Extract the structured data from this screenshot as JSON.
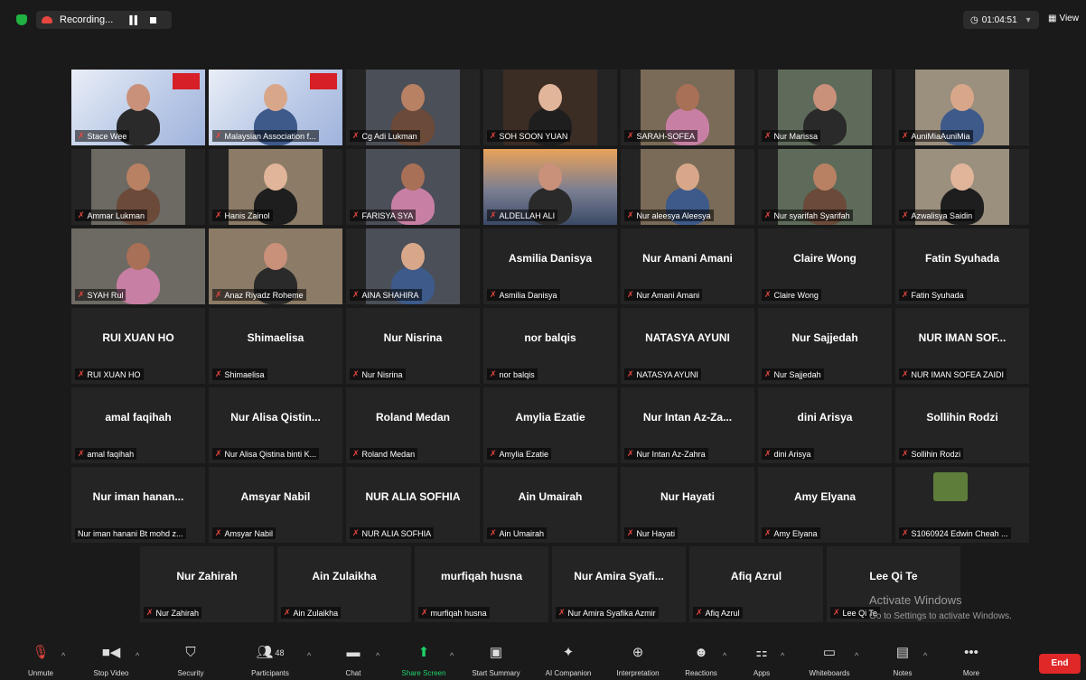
{
  "recording": {
    "label": "Recording...",
    "pause_icon": "pause-icon",
    "stop_icon": "stop-icon"
  },
  "timer": {
    "value": "01:04:51"
  },
  "view": {
    "label": "View"
  },
  "grid": [
    {
      "big": "",
      "name": "Stace Wee",
      "video": true
    },
    {
      "big": "",
      "name": "Malaysian Association f...",
      "video": true
    },
    {
      "big": "",
      "name": "Cg Adi Lukman",
      "video": true
    },
    {
      "big": "",
      "name": "SOH SOON YUAN",
      "video": true
    },
    {
      "big": "",
      "name": "SARAH-SOFEA",
      "video": true
    },
    {
      "big": "",
      "name": "Nur Marissa",
      "video": true
    },
    {
      "big": "",
      "name": "AuniMiaAuniMia",
      "video": true
    },
    {
      "big": "",
      "name": "Ammar Lukman",
      "video": true
    },
    {
      "big": "",
      "name": "Hanis Zainol",
      "video": true
    },
    {
      "big": "",
      "name": "FARISYA SYA",
      "video": true
    },
    {
      "big": "",
      "name": "ALDELLAH ALI",
      "video": true
    },
    {
      "big": "",
      "name": "Nur aleesya Aleesya",
      "video": true
    },
    {
      "big": "",
      "name": "Nur syarifah Syarifah",
      "video": true
    },
    {
      "big": "",
      "name": "Azwalisya Saidin",
      "video": true
    },
    {
      "big": "",
      "name": "SYAH Rul",
      "video": true
    },
    {
      "big": "",
      "name": "Anaz Riyadz Roheme",
      "video": true
    },
    {
      "big": "",
      "name": "AINA SHAHIRA",
      "video": true
    },
    {
      "big": "Asmilia Danisya",
      "name": "Asmilia Danisya"
    },
    {
      "big": "Nur Amani Amani",
      "name": "Nur Amani Amani"
    },
    {
      "big": "Claire Wong",
      "name": "Claire Wong"
    },
    {
      "big": "Fatin Syuhada",
      "name": "Fatin Syuhada"
    },
    {
      "big": "RUI XUAN HO",
      "name": "RUI XUAN HO"
    },
    {
      "big": "Shimaelisa",
      "name": "Shimaelisa"
    },
    {
      "big": "Nur Nisrina",
      "name": "Nur Nisrina"
    },
    {
      "big": "nor balqis",
      "name": "nor balqis"
    },
    {
      "big": "NATASYA AYUNI",
      "name": "NATASYA AYUNI"
    },
    {
      "big": "Nur Sajjedah",
      "name": "Nur Sajjedah"
    },
    {
      "big": "NUR IMAN SOF...",
      "name": "NUR IMAN SOFEA ZAIDI"
    },
    {
      "big": "amal faqihah",
      "name": "amal faqihah"
    },
    {
      "big": "Nur Alisa Qistin...",
      "name": "Nur Alisa Qistina binti K..."
    },
    {
      "big": "Roland Medan",
      "name": "Roland Medan"
    },
    {
      "big": "Amylia Ezatie",
      "name": "Amylia Ezatie"
    },
    {
      "big": "Nur Intan Az-Za...",
      "name": "Nur Intan Az-Zahra"
    },
    {
      "big": "dini Arisya",
      "name": "dini Arisya"
    },
    {
      "big": "Sollihin Rodzi",
      "name": "Sollihin Rodzi"
    },
    {
      "big": "Nur iman hanan...",
      "name": "Nur iman hanani Bt mohd z..."
    },
    {
      "big": "Amsyar Nabil",
      "name": "Amsyar Nabil"
    },
    {
      "big": "NUR ALIA SOFHIA",
      "name": "NUR ALIA SOFHIA"
    },
    {
      "big": "Ain Umairah",
      "name": "Ain Umairah"
    },
    {
      "big": "Nur Hayati",
      "name": "Nur Hayati"
    },
    {
      "big": "Amy Elyana",
      "name": "Amy Elyana"
    },
    {
      "big": "",
      "name": "S1060924 Edwin Cheah ...",
      "avatar": true
    }
  ],
  "last_row": [
    {
      "big": "Nur Zahirah",
      "name": "Nur Zahirah"
    },
    {
      "big": "Ain Zulaikha",
      "name": "Ain Zulaikha"
    },
    {
      "big": "murfiqah husna",
      "name": "murfiqah husna"
    },
    {
      "big": "Nur Amira Syafi...",
      "name": "Nur Amira Syafika Azmir"
    },
    {
      "big": "Afiq Azrul",
      "name": "Afiq Azrul"
    },
    {
      "big": "Lee Qi Te",
      "name": "Lee Qi Te"
    }
  ],
  "watermark": {
    "title": "Activate Windows",
    "subtitle": "Go to Settings to activate Windows."
  },
  "toolbar": {
    "unmute": "Unmute",
    "stop_video": "Stop Video",
    "security": "Security",
    "participants": "Participants",
    "participants_count": "48",
    "chat": "Chat",
    "share_screen": "Share Screen",
    "start_summary": "Start Summary",
    "ai_companion": "AI Companion",
    "interpretation": "Interpretation",
    "reactions": "Reactions",
    "apps": "Apps",
    "whiteboards": "Whiteboards",
    "notes": "Notes",
    "more": "More",
    "end": "End"
  },
  "colors": {
    "share_green": "#1fd16a",
    "end_red": "#e02828",
    "active_outline": "#d4e640",
    "muted_red": "#e7463f"
  }
}
